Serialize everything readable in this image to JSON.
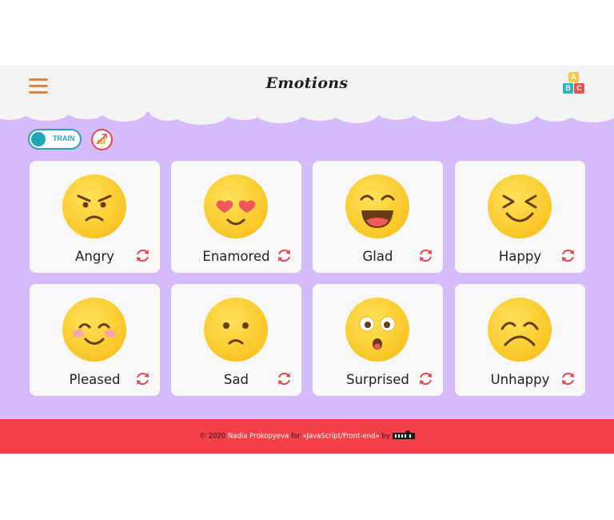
{
  "header": {
    "logo_text": "Emotions",
    "abc_letters": [
      "A",
      "B",
      "C"
    ]
  },
  "controls": {
    "mode_toggle_label": "TRAIN"
  },
  "cards": [
    {
      "word": "Angry",
      "face": "angry"
    },
    {
      "word": "Enamored",
      "face": "enamored"
    },
    {
      "word": "Glad",
      "face": "glad"
    },
    {
      "word": "Happy",
      "face": "happy"
    },
    {
      "word": "Pleased",
      "face": "pleased"
    },
    {
      "word": "Sad",
      "face": "sad"
    },
    {
      "word": "Surprised",
      "face": "surprised"
    },
    {
      "word": "Unhappy",
      "face": "unhappy"
    }
  ],
  "footer": {
    "copyright": "© 2020",
    "author": "Nadia Prokopyeva",
    "for_text": "for",
    "course": "«JavaScript/Front-end»",
    "by_text": "by"
  },
  "colors": {
    "page_background": "#d6bbfb",
    "header_background": "#f4f4f4",
    "footer_background": "#f43f48",
    "toggle_accent": "#23a6b5",
    "flip_icon": "#e8474c",
    "emoji_yellow": "#fcd22e"
  }
}
